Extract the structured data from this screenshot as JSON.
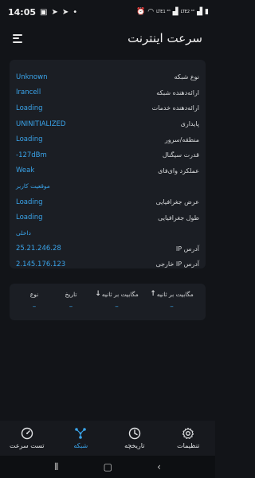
{
  "status_bar": {
    "time": "14:05",
    "network_small": "LTE1 ⁴ᴳ",
    "network_small2": "LTE2 ⁴ᴳ"
  },
  "app": {
    "title": "سرعت اینترنت"
  },
  "info": {
    "rows": [
      {
        "label": "نوع شبکه",
        "value": "Unknown"
      },
      {
        "label": "ارائه‌دهنده شبکه",
        "value": "Irancell"
      },
      {
        "label": "ارائه‌دهنده خدمات",
        "value": "Loading"
      },
      {
        "label": "پایداری",
        "value": "UNINITIALIZED"
      },
      {
        "label": "منطقه/سرور",
        "value": "Loading"
      },
      {
        "label": "قدرت سیگنال",
        "value": "-127dBm"
      },
      {
        "label": "عملکرد وای‌فای",
        "value": "Weak"
      }
    ],
    "section_location": "موقعیت کاربر",
    "location_rows": [
      {
        "label": "عرض جغرافیایی",
        "value": "Loading"
      },
      {
        "label": "طول جغرافیایی",
        "value": "Loading"
      }
    ],
    "section_internal": "داخلی",
    "ip_rows": [
      {
        "label": "آدرس IP",
        "value": "25.21.246.28"
      },
      {
        "label": "آدرس IP خارجی",
        "value": "2.145.176.123"
      }
    ]
  },
  "speed": {
    "headers": {
      "upload": "مگابیت بر ثانیه",
      "download": "مگابیت بر ثانیه",
      "date": "تاریخ",
      "type": "نوع"
    },
    "values": {
      "upload": "–",
      "download": "–",
      "date": "–",
      "type": "–"
    }
  },
  "bottom_nav": {
    "settings": "تنظیمات",
    "history": "تاریخچه",
    "network": "شبکه",
    "speed_test": "تست سرعت"
  },
  "colors": {
    "accent": "#3aa4ea",
    "download_arrow": "#4cd964",
    "background": "#121418",
    "card": "#1b1e24"
  }
}
